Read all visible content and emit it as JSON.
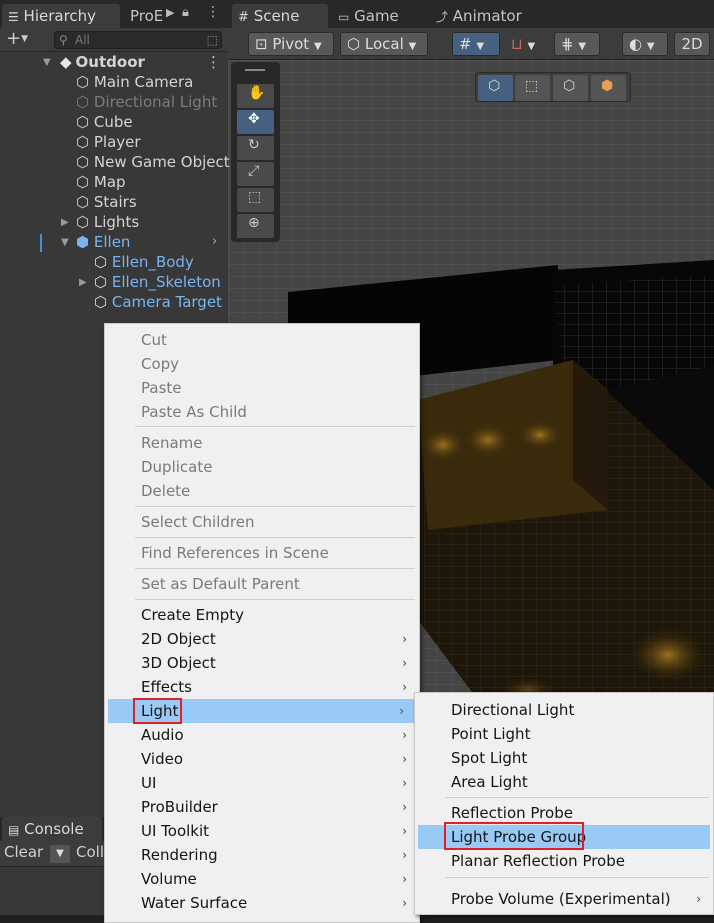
{
  "hierarchy": {
    "tabs": [
      "Hierarchy",
      "ProE"
    ],
    "search_placeholder": "All",
    "add_label": "+",
    "items": [
      {
        "label": "Outdoor",
        "style": "bold"
      },
      {
        "label": "Main Camera",
        "style": "normal"
      },
      {
        "label": "Directional Light",
        "style": "dim"
      },
      {
        "label": "Cube",
        "style": "normal"
      },
      {
        "label": "Player",
        "style": "normal"
      },
      {
        "label": "New Game Object",
        "style": "normal"
      },
      {
        "label": "Map",
        "style": "normal"
      },
      {
        "label": "Stairs",
        "style": "normal"
      },
      {
        "label": "Lights",
        "style": "normal"
      },
      {
        "label": "Ellen",
        "style": "blue"
      },
      {
        "label": "Ellen_Body",
        "style": "blue"
      },
      {
        "label": "Ellen_Skeleton",
        "style": "blue"
      },
      {
        "label": "Camera Target",
        "style": "blue"
      }
    ]
  },
  "scene": {
    "tabs": [
      "Scene",
      "Game",
      "Animator"
    ],
    "toolbar": {
      "pivot": "Pivot",
      "local": "Local",
      "mode_2d": "2D"
    }
  },
  "console": {
    "tab": "Console",
    "clear": "Clear",
    "collapse": "Coll"
  },
  "context_menu": {
    "items": [
      {
        "label": "Cut",
        "disabled": true
      },
      {
        "label": "Copy",
        "disabled": true
      },
      {
        "label": "Paste",
        "disabled": true
      },
      {
        "label": "Paste As Child",
        "disabled": true
      },
      {
        "label": "Rename",
        "disabled": true
      },
      {
        "label": "Duplicate",
        "disabled": true
      },
      {
        "label": "Delete",
        "disabled": true
      },
      {
        "label": "Select Children",
        "disabled": true
      },
      {
        "label": "Find References in Scene",
        "disabled": true
      },
      {
        "label": "Set as Default Parent",
        "disabled": true
      },
      {
        "label": "Create Empty",
        "disabled": false
      },
      {
        "label": "2D Object",
        "disabled": false,
        "submenu": true
      },
      {
        "label": "3D Object",
        "disabled": false,
        "submenu": true
      },
      {
        "label": "Effects",
        "disabled": false,
        "submenu": true
      },
      {
        "label": "Light",
        "disabled": false,
        "submenu": true,
        "highlighted": true
      },
      {
        "label": "Audio",
        "disabled": false,
        "submenu": true
      },
      {
        "label": "Video",
        "disabled": false,
        "submenu": true
      },
      {
        "label": "UI",
        "disabled": false,
        "submenu": true
      },
      {
        "label": "ProBuilder",
        "disabled": false,
        "submenu": true
      },
      {
        "label": "UI Toolkit",
        "disabled": false,
        "submenu": true
      },
      {
        "label": "Rendering",
        "disabled": false,
        "submenu": true
      },
      {
        "label": "Volume",
        "disabled": false,
        "submenu": true
      },
      {
        "label": "Water Surface",
        "disabled": false,
        "submenu": true
      }
    ]
  },
  "light_submenu": {
    "items": [
      {
        "label": "Directional Light"
      },
      {
        "label": "Point Light"
      },
      {
        "label": "Spot Light"
      },
      {
        "label": "Area Light"
      },
      {
        "label": "Reflection Probe"
      },
      {
        "label": "Light Probe Group",
        "highlighted": true
      },
      {
        "label": "Planar Reflection Probe"
      },
      {
        "label": "Probe Volume (Experimental)",
        "submenu": true
      }
    ]
  },
  "colors": {
    "highlight": "#99c9f5",
    "annotation_box": "#e0202a",
    "selected_text": "#7ab4f0",
    "accent_button": "#46607f"
  }
}
